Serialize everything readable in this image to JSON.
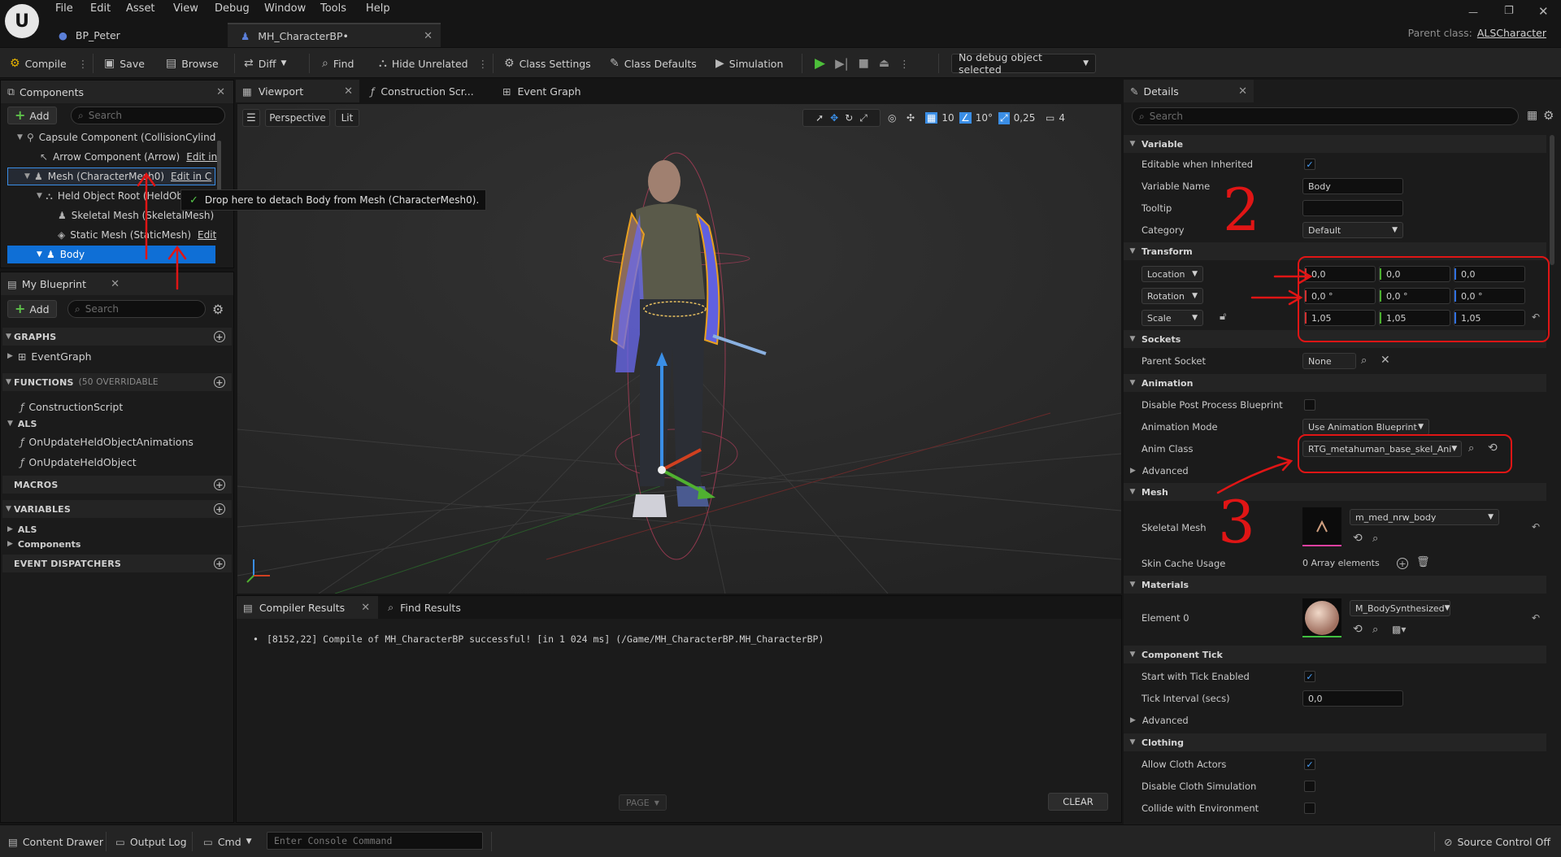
{
  "app": {
    "logo_letter": "U"
  },
  "menu": [
    "File",
    "Edit",
    "Asset",
    "View",
    "Debug",
    "Window",
    "Tools",
    "Help"
  ],
  "doc_tabs": [
    {
      "label": "BP_Peter"
    },
    {
      "label": "MH_CharacterBP•"
    }
  ],
  "parent_class": {
    "label": "Parent class:",
    "value": "ALSCharacter"
  },
  "toolbar": {
    "compile": "Compile",
    "save": "Save",
    "browse": "Browse",
    "diff": "Diff",
    "find": "Find",
    "hide_unrelated": "Hide Unrelated",
    "class_settings": "Class Settings",
    "class_defaults": "Class Defaults",
    "simulation": "Simulation",
    "debug_object": "No debug object selected"
  },
  "components": {
    "title": "Components",
    "add_label": "Add",
    "search_placeholder": "Search",
    "tree": [
      {
        "label": "Capsule Component (CollisionCylind"
      },
      {
        "label": "Arrow Component (Arrow)",
        "edit": "Edit in"
      },
      {
        "label": "Mesh (CharacterMesh0)",
        "edit": "Edit in C"
      },
      {
        "label": "Held Object Root (HeldOb"
      },
      {
        "label": "Skeletal Mesh (SkeletalMesh)"
      },
      {
        "label": "Static Mesh (StaticMesh)",
        "edit": "Edit"
      },
      {
        "label": "Body"
      }
    ],
    "tooltip": "Drop here to detach Body from Mesh (CharacterMesh0)."
  },
  "my_blueprint": {
    "title": "My Blueprint",
    "add_label": "Add",
    "search_placeholder": "Search",
    "graphs_header": "GRAPHS",
    "event_graph": "EventGraph",
    "functions_header": "FUNCTIONS",
    "functions_count": "(50 OVERRIDABLE",
    "construction_script": "ConstructionScript",
    "als": "ALS",
    "fn1": "OnUpdateHeldObjectAnimations",
    "fn2": "OnUpdateHeldObject",
    "macros_header": "MACROS",
    "variables_header": "VARIABLES",
    "var_als": "ALS",
    "var_components": "Components",
    "dispatchers_header": "EVENT DISPATCHERS"
  },
  "editor_tabs": [
    {
      "label": "Viewport"
    },
    {
      "label": "Construction Scr..."
    },
    {
      "label": "Event Graph"
    }
  ],
  "viewport": {
    "perspective": "Perspective",
    "lit": "Lit",
    "grid_snap": "10",
    "rot_snap": "10°",
    "scale_snap": "0,25",
    "cam_speed": "4"
  },
  "compiler": {
    "tab": "Compiler Results",
    "find_tab": "Find Results",
    "message": "[8152,22] Compile of MH_CharacterBP successful! [in 1 024 ms] (/Game/MH_CharacterBP.MH_CharacterBP)",
    "page": "PAGE",
    "clear": "CLEAR"
  },
  "details": {
    "title": "Details",
    "search_placeholder": "Search",
    "variable": {
      "header": "Variable",
      "editable_label": "Editable when Inherited",
      "name_label": "Variable Name",
      "name_value": "Body",
      "tooltip_label": "Tooltip",
      "category_label": "Category",
      "category_value": "Default"
    },
    "transform": {
      "header": "Transform",
      "location": "Location",
      "rotation": "Rotation",
      "scale": "Scale",
      "loc": [
        "0,0",
        "0,0",
        "0,0"
      ],
      "rot": [
        "0,0 °",
        "0,0 °",
        "0,0 °"
      ],
      "scl": [
        "1,05",
        "1,05",
        "1,05"
      ]
    },
    "sockets": {
      "header": "Sockets",
      "parent_label": "Parent Socket",
      "parent_value": "None"
    },
    "animation": {
      "header": "Animation",
      "disable_pp": "Disable Post Process Blueprint",
      "mode_label": "Animation Mode",
      "mode_value": "Use Animation Blueprint",
      "class_label": "Anim Class",
      "class_value": "RTG_metahuman_base_skel_Ani",
      "advanced": "Advanced"
    },
    "mesh": {
      "header": "Mesh",
      "skeletal_label": "Skeletal Mesh",
      "skeletal_value": "m_med_nrw_body",
      "skin_label": "Skin Cache Usage",
      "skin_value": "0 Array elements"
    },
    "materials": {
      "header": "Materials",
      "element_label": "Element 0",
      "element_value": "M_BodySynthesized"
    },
    "tick": {
      "header": "Component Tick",
      "start_label": "Start with Tick Enabled",
      "interval_label": "Tick Interval (secs)",
      "interval_value": "0,0",
      "advanced": "Advanced"
    },
    "clothing": {
      "header": "Clothing",
      "allow_label": "Allow Cloth Actors",
      "disable_label": "Disable Cloth Simulation",
      "collide_label": "Collide with Environment"
    }
  },
  "annotations": {
    "num2": "2",
    "num3": "3"
  },
  "statusbar": {
    "content_drawer": "Content Drawer",
    "output_log": "Output Log",
    "cmd": "Cmd",
    "console_placeholder": "Enter Console Command",
    "source_control": "Source Control Off"
  }
}
